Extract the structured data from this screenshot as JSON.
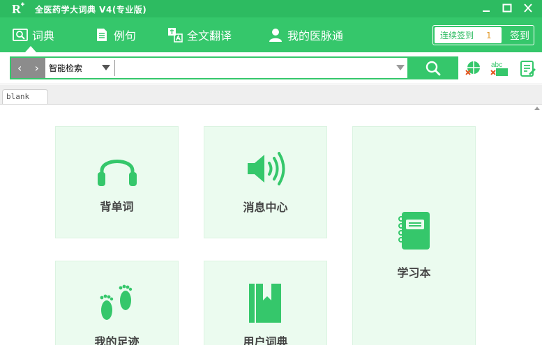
{
  "window": {
    "title": "全医药学大词典 V4(专业版)",
    "logo_text": "R"
  },
  "nav": {
    "items": [
      {
        "label": "词典",
        "icon": "dictionary-icon",
        "active": true
      },
      {
        "label": "例句",
        "icon": "document-icon",
        "active": false
      },
      {
        "label": "全文翻译",
        "icon": "translate-icon",
        "active": false
      },
      {
        "label": "我的医脉通",
        "icon": "user-icon",
        "active": false
      }
    ],
    "checkin_label": "连续签到",
    "checkin_count": "1",
    "checkin_button": "签到"
  },
  "search": {
    "mode": "智能检索",
    "value": "",
    "prev_icon": "chevron-left-icon",
    "next_icon": "chevron-right-icon"
  },
  "tabs": [
    {
      "label": "blank"
    }
  ],
  "tiles": [
    {
      "label": "背单词",
      "icon": "headphones-icon"
    },
    {
      "label": "消息中心",
      "icon": "speaker-icon"
    },
    {
      "label": "学习本",
      "icon": "notebook-icon"
    },
    {
      "label": "我的足迹",
      "icon": "footprints-icon"
    },
    {
      "label": "用户词典",
      "icon": "bookmark-book-icon"
    }
  ],
  "colors": {
    "titlebar": "#2dbb61",
    "navbar": "#35c76b",
    "accent": "#35c76b",
    "tile_bg": "#ebfbef",
    "tile_icon": "#35c76b",
    "checkin_count": "#e29a2b"
  }
}
